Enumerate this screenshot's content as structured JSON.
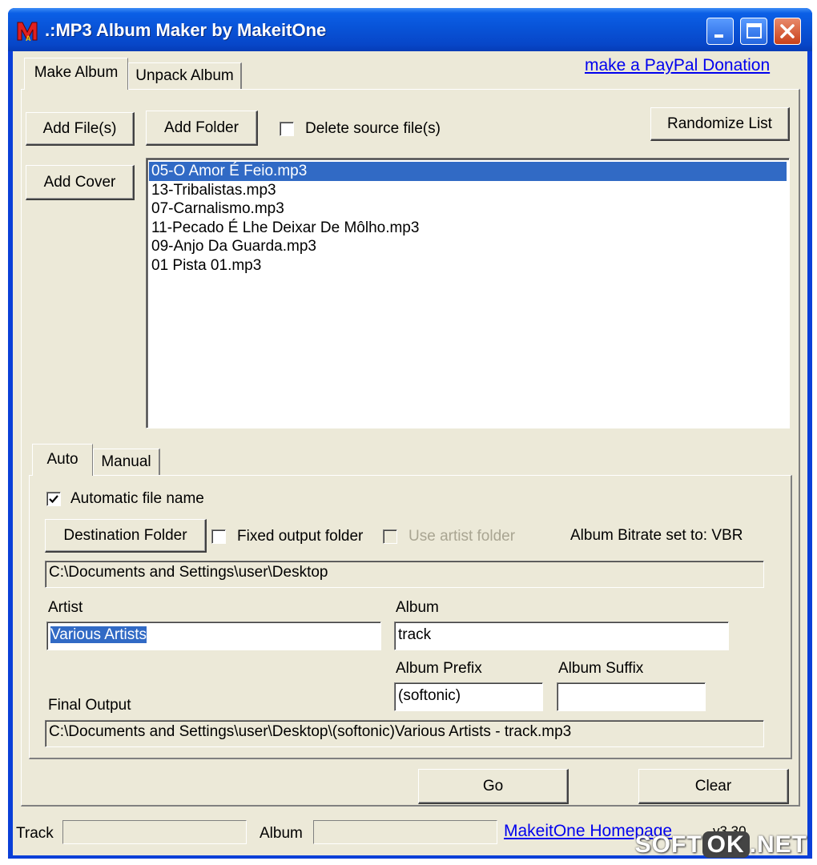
{
  "window": {
    "title": ".:MP3 Album Maker by MakeitOne",
    "icon": "app-logo-icon",
    "controls": [
      "minimize-icon",
      "maximize-icon",
      "close-icon"
    ]
  },
  "top_tabs": [
    {
      "label": "Make Album",
      "active": true
    },
    {
      "label": "Unpack Album",
      "active": false
    }
  ],
  "donation_link": "make a PayPal Donation",
  "toolbar": {
    "add_files": "Add File(s)",
    "add_folder": "Add Folder",
    "delete_source": "Delete source file(s)",
    "randomize": "Randomize List",
    "add_cover": "Add Cover"
  },
  "file_list": {
    "items": [
      "05-O Amor É Feio.mp3",
      "13-Tribalistas.mp3",
      "07-Carnalismo.mp3",
      "11-Pecado É Lhe Deixar De Môlho.mp3",
      "09-Anjo Da Guarda.mp3",
      "01 Pista 01.mp3"
    ],
    "selected_index": 0
  },
  "sub_tabs": [
    {
      "label": "Auto",
      "active": true
    },
    {
      "label": "Manual",
      "active": false
    }
  ],
  "auto": {
    "automatic_file_name": "Automatic file name",
    "automatic_checked": true,
    "destination_button": "Destination Folder",
    "fixed_output": "Fixed output folder",
    "use_artist_folder": "Use artist folder",
    "bitrate_text": "Album Bitrate set to: VBR",
    "destination_path": "C:\\Documents and Settings\\user\\Desktop",
    "artist_label": "Artist",
    "artist_value": "Various Artists",
    "album_label": "Album",
    "album_value": "track",
    "prefix_label": "Album Prefix",
    "prefix_value": "(softonic)",
    "suffix_label": "Album Suffix",
    "suffix_value": "",
    "final_output_label": "Final Output",
    "final_output_value": "C:\\Documents and Settings\\user\\Desktop\\(softonic)Various Artists - track.mp3"
  },
  "actions": {
    "go": "Go",
    "clear": "Clear"
  },
  "status": {
    "track_label": "Track",
    "album_label": "Album",
    "homepage_link": "MakeitOne Homepage",
    "version": "v3.30"
  },
  "watermark": {
    "part1": "SOFT",
    "part2": "OK",
    "part3": ".NET"
  },
  "colors": {
    "titlebar": "#0852d6",
    "selection": "#316ac5",
    "window_bg": "#ece9d8"
  }
}
